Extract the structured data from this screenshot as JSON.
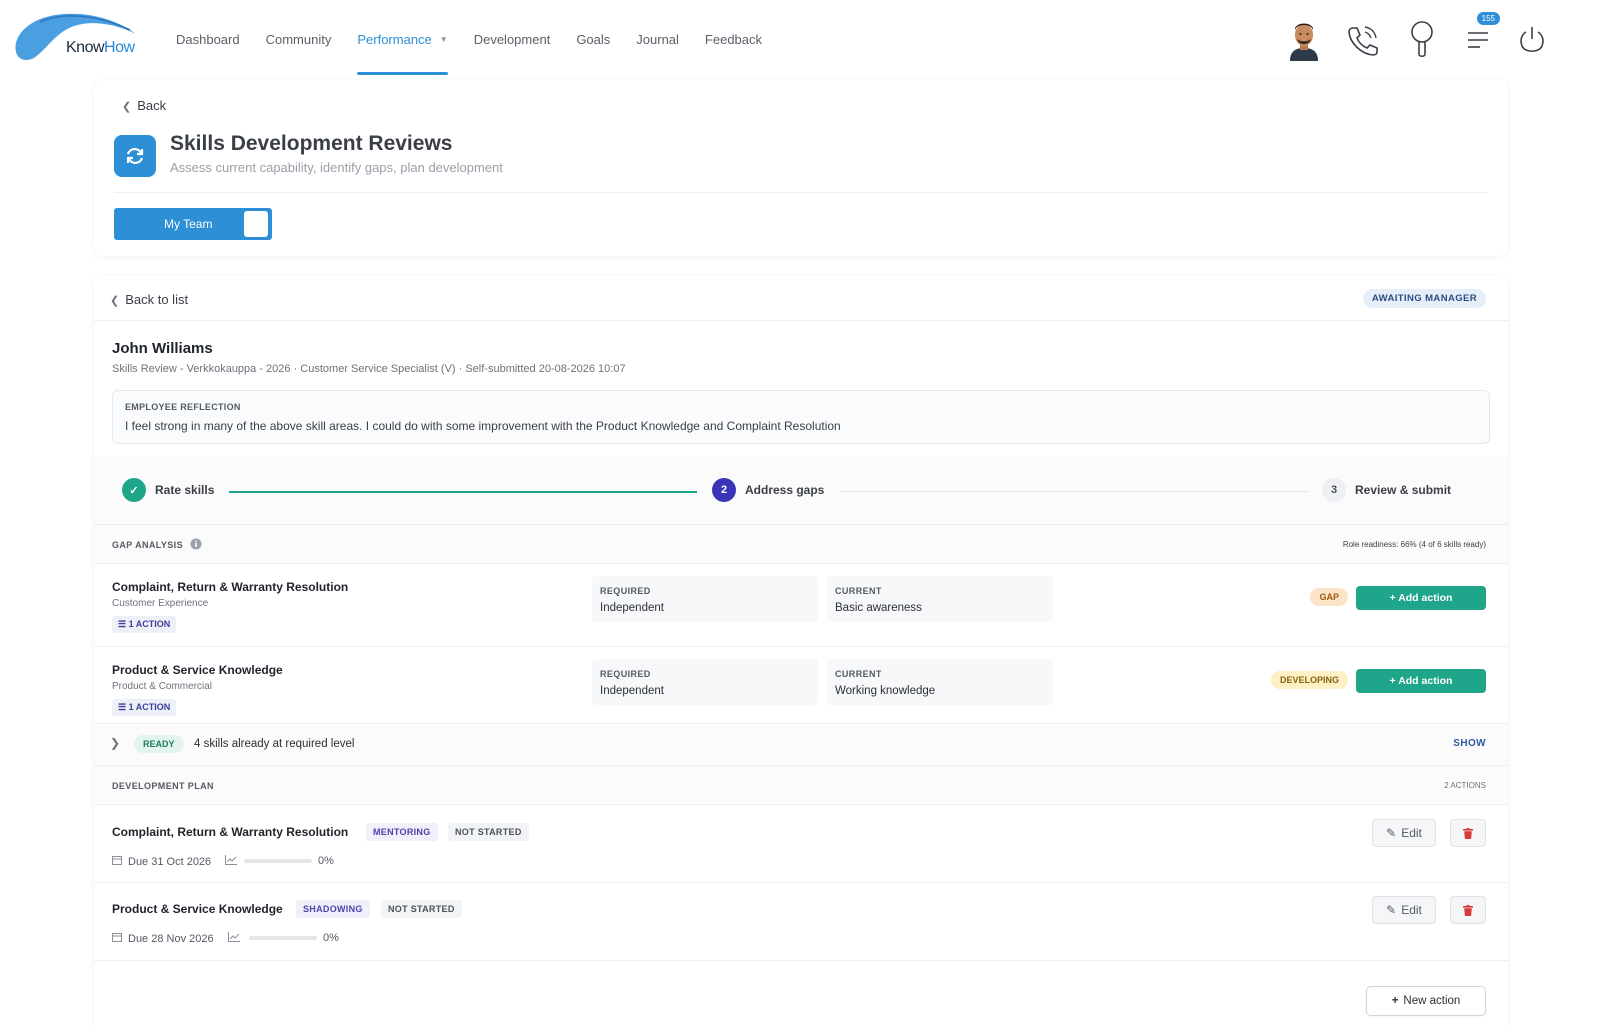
{
  "app": {
    "logo_word_1": "Know",
    "logo_word_2": "How",
    "brand_color": "#2d8fd5"
  },
  "nav": {
    "items": [
      {
        "label": "Dashboard"
      },
      {
        "label": "Community"
      },
      {
        "label": "Performance",
        "active": true,
        "has_dropdown": true
      },
      {
        "label": "Development"
      },
      {
        "label": "Goals"
      },
      {
        "label": "Journal"
      },
      {
        "label": "Feedback"
      }
    ]
  },
  "top_icons": {
    "avatar": "user-avatar",
    "phone": "phone-icon",
    "search": "search-icon",
    "menu": "menu-icon",
    "notifications_count": "155",
    "power": "power-icon"
  },
  "header": {
    "back_label": "Back",
    "title": "Skills Development Reviews",
    "subtitle": "Assess current capability, identify gaps, plan development",
    "toggle_label": "My Team"
  },
  "review": {
    "back_label": "Back to list",
    "status": "AWAITING MANAGER",
    "employee_name": "John Williams",
    "meta": "Skills Review - Verkkokauppa - 2026 · Customer Service Specialist (V) · Self-submitted 20-08-2026 10:07",
    "reflection_label": "EMPLOYEE REFLECTION",
    "reflection_text": "I feel strong in many of the above skill areas. I could do with some improvement with the Product Knowledge and Complaint Resolution"
  },
  "steps": [
    {
      "number": "",
      "label": "Rate skills",
      "state": "done"
    },
    {
      "number": "2",
      "label": "Address gaps",
      "state": "current"
    },
    {
      "number": "3",
      "label": "Review & submit",
      "state": "todo"
    }
  ],
  "gap_analysis": {
    "label": "GAP ANALYSIS",
    "readiness": "Role readiness: 66% (4 of 6 skills ready)",
    "rows": [
      {
        "skill": "Complaint, Return & Warranty Resolution",
        "category": "Customer Experience",
        "actions": "1 ACTION",
        "required_label": "REQUIRED",
        "required": "Independent",
        "current_label": "CURRENT",
        "current": "Basic awareness",
        "status": "GAP",
        "add_label": "+ Add action"
      },
      {
        "skill": "Product & Service Knowledge",
        "category": "Product & Commercial",
        "actions": "1 ACTION",
        "required_label": "REQUIRED",
        "required": "Independent",
        "current_label": "CURRENT",
        "current": "Working knowledge",
        "status": "DEVELOPING",
        "add_label": "+ Add action"
      }
    ],
    "ready": {
      "pill": "READY",
      "text": "4 skills already at required level",
      "show_label": "SHOW"
    }
  },
  "development_plan": {
    "label": "DEVELOPMENT PLAN",
    "count": "2 ACTIONS",
    "items": [
      {
        "skill": "Complaint, Return & Warranty Resolution",
        "method": "MENTORING",
        "state": "NOT STARTED",
        "due": "Due 31 Oct 2026",
        "progress": 0,
        "progress_label": "0%",
        "edit_label": "Edit"
      },
      {
        "skill": "Product & Service Knowledge",
        "method": "SHADOWING",
        "state": "NOT STARTED",
        "due": "Due 28 Nov 2026",
        "progress": 0,
        "progress_label": "0%",
        "edit_label": "Edit"
      }
    ],
    "new_action_label": "New action"
  },
  "colors": {
    "accent": "#2d8fd5",
    "success": "#1fa58a",
    "step_current": "#3a35b8",
    "gap": "#fbe3c8",
    "developing": "#fdf0c4",
    "delete": "#d63b3b"
  }
}
